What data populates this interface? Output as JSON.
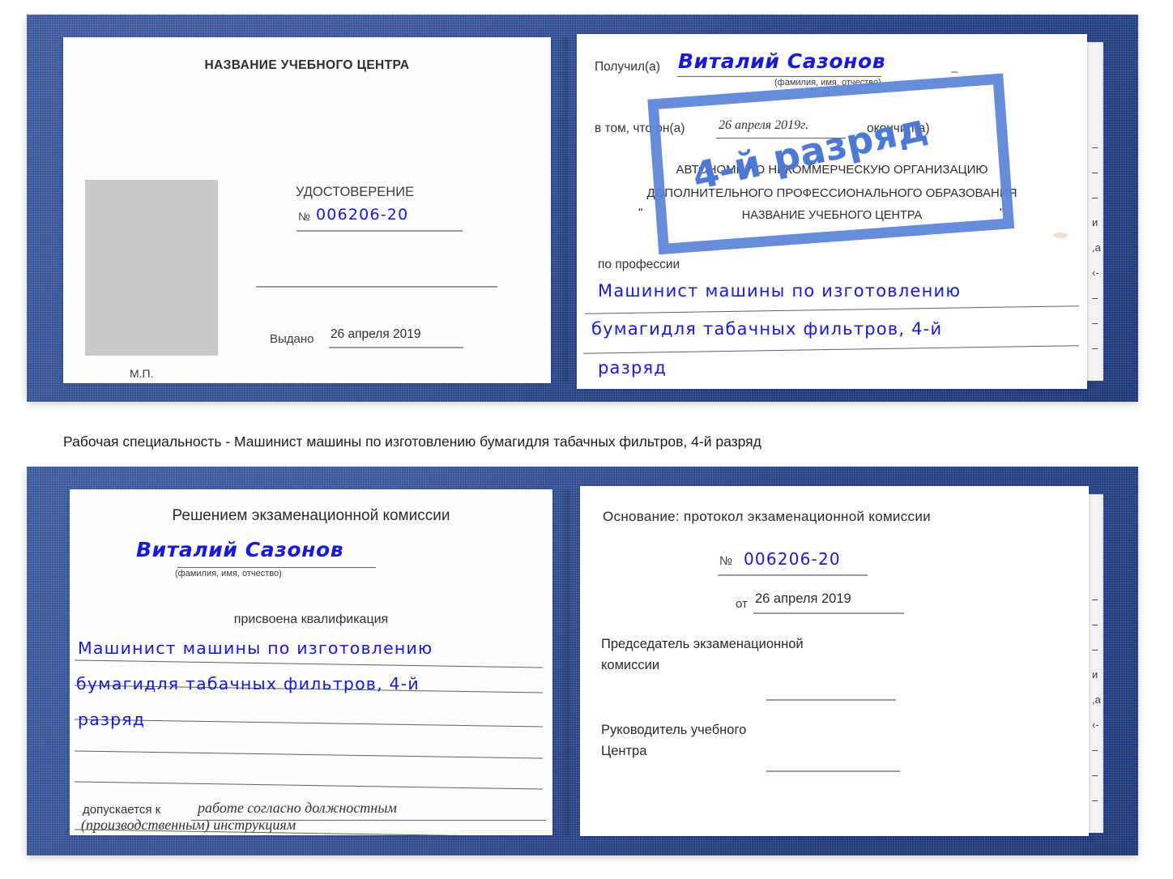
{
  "caption": {
    "text": "Рабочая специальность - Машинист машины по изготовлению бумагидля табачных фильтров, 4-й разряд"
  },
  "certificate_top": {
    "left_page": {
      "header": "НАЗВАНИЕ УЧЕБНОГО ЦЕНТРА",
      "doc_type": "УДОСТОВЕРЕНИЕ",
      "number_label": "№",
      "number_value": "006206-20",
      "issued_label": "Выдано",
      "issued_value": "26 апреля 2019",
      "seal_mark": "М.П.",
      "photo_placeholder": "photo-placeholder"
    },
    "right_page": {
      "received_label": "Получил(а)",
      "received_value": "Виталий Сазонов",
      "name_hint": "(фамилия, имя, отчество)",
      "in_that_label": "в том, что он(а)",
      "completion_date": "26 апреля 2019г.",
      "finished_label": "окончил(а)",
      "org_line1": "АВТОНОМНУЮ НЕКОММЕРЧЕСКУЮ ОРГАНИЗАЦИЮ",
      "org_line2": "ДОПОЛНИТЕЛЬНОГО ПРОФЕССИОНАЛЬНОГО ОБРАЗОВАНИЯ",
      "org_quote_open": "\"",
      "org_name": "НАЗВАНИЕ УЧЕБНОГО ЦЕНТРА",
      "org_quote_close": "\"",
      "profession_label": "по профессии",
      "profession_line1": "Машинист машины по изготовлению",
      "profession_line2": "бумагидля табачных фильтров, 4-й",
      "profession_line3": "разряд",
      "edge_chars": "– – – и ,а ‹- – – – –"
    },
    "stamp": {
      "text": "4-й разряд",
      "color": "#5a82d6"
    }
  },
  "certificate_bottom": {
    "left_page": {
      "header": "Решением экзаменационной комиссии",
      "name_value": "Виталий Сазонов",
      "name_hint": "(фамилия, имя, отчество)",
      "qualification_label": "присвоена квалификация",
      "qualification_line1": "Машинист машины по изготовлению",
      "qualification_line2": "бумагидля табачных фильтров, 4-й",
      "qualification_line3": "разряд",
      "admitted_label": "допускается к",
      "admitted_value_line1": "работе согласно должностным",
      "admitted_value_line2": "(производственным) инструкциям"
    },
    "right_page": {
      "basis_label": "Основание: протокол экзаменационной комиссии",
      "number_label": "№",
      "number_value": "006206-20",
      "date_label": "от",
      "date_value": "26 апреля 2019",
      "chairman_line1": "Председатель экзаменационной",
      "chairman_line2": "комиссии",
      "head_line1": "Руководитель учебного",
      "head_line2": "Центра",
      "edge_chars": "– – – и ,а ‹- – – – –"
    }
  },
  "colors": {
    "cover_blue": "#23438f",
    "ink_blue": "#1a19d6",
    "stamp_blue": "#5a82d6",
    "photo_gray": "#c9c9c9",
    "rule_gray": "#9b9b9b"
  }
}
